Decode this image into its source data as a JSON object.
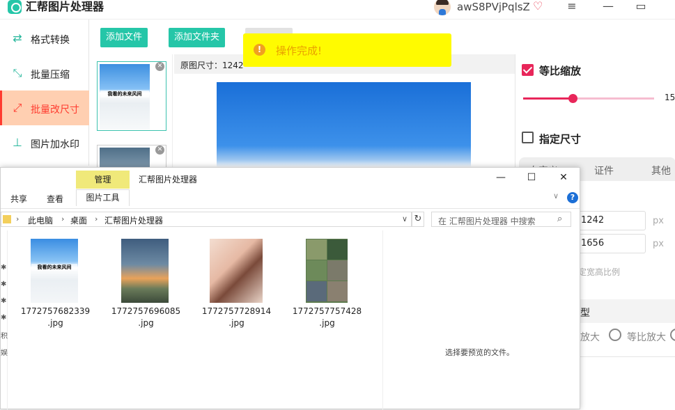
{
  "app": {
    "title": "汇帮图片处理器",
    "user_name": "awS8PVjPqlsZ",
    "window_buttons": [
      "≡",
      "—",
      "▭"
    ]
  },
  "sidebar": {
    "items": [
      {
        "label": "格式转换",
        "icon": "format-convert-icon"
      },
      {
        "label": "批量压缩",
        "icon": "compress-icon"
      },
      {
        "label": "批量改尺寸",
        "icon": "resize-icon",
        "active": true
      },
      {
        "label": "图片加水印",
        "icon": "watermark-icon"
      }
    ]
  },
  "toolbar": {
    "add_file": "添加文件",
    "add_folder": "添加文件夹"
  },
  "thumbnails": {
    "caption": "我看的未来风间"
  },
  "info_bar": {
    "text": "原图尺寸：1242"
  },
  "toast": {
    "text": "操作完成!",
    "icon": "info-icon"
  },
  "right_panel": {
    "proportional_label": "等比缩放",
    "proportional_checked": true,
    "scale_value": "15",
    "scale_fraction": 0.38,
    "fixed_size_label": "指定尺寸",
    "fixed_size_checked": false,
    "tabs": [
      "自定义",
      "证件",
      "其他"
    ],
    "width_value": "1242",
    "height_value": "1656",
    "unit": "px",
    "ratio_text": "定宽高比例",
    "section_title": "型",
    "radio_options": [
      "放大",
      "等比放大"
    ],
    "accent_color": "#e8265a"
  },
  "explorer": {
    "manage_tab": "管理",
    "window_title": "汇帮图片处理器",
    "ribbon_tabs": [
      "共享",
      "查看",
      "图片工具"
    ],
    "breadcrumb": [
      "此电脑",
      "桌面",
      "汇帮图片处理器"
    ],
    "search_placeholder": "在 汇帮图片处理器 中搜索",
    "preview_message": "选择要预览的文件。",
    "files": [
      {
        "name_line1": "1772757682339",
        "name_line2": ".jpg",
        "caption": "我看的未来风间"
      },
      {
        "name_line1": "1772757696085",
        "name_line2": ".jpg"
      },
      {
        "name_line1": "1772757728914",
        "name_line2": ".jpg"
      },
      {
        "name_line1": "1772757757428",
        "name_line2": ".jpg"
      }
    ],
    "nav_glyphs": [
      "✱",
      "✱",
      "✱",
      "✱",
      "积",
      "娱"
    ]
  }
}
